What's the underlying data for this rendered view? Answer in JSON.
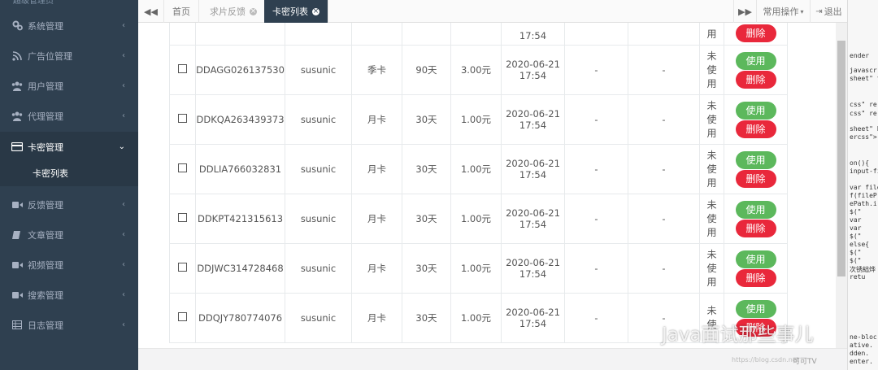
{
  "sidebar": {
    "top_text": "超级管理员",
    "items": [
      {
        "label": "系统管理",
        "icon": "gears-icon"
      },
      {
        "label": "广告位管理",
        "icon": "rss-icon"
      },
      {
        "label": "用户管理",
        "icon": "users-icon"
      },
      {
        "label": "代理管理",
        "icon": "users-icon"
      },
      {
        "label": "卡密管理",
        "icon": "credit-card-icon"
      },
      {
        "label": "反馈管理",
        "icon": "video-icon"
      },
      {
        "label": "文章管理",
        "icon": "book-icon"
      },
      {
        "label": "视频管理",
        "icon": "video-icon"
      },
      {
        "label": "搜索管理",
        "icon": "video-icon"
      },
      {
        "label": "日志管理",
        "icon": "table-icon"
      }
    ],
    "submenu_label": "卡密列表"
  },
  "topbar": {
    "tabs": [
      {
        "label": "首页"
      },
      {
        "label": "求片反馈"
      },
      {
        "label": "卡密列表"
      }
    ],
    "common_ops": "常用操作",
    "logout": "退出"
  },
  "table": {
    "partial_row": {
      "date_time": "17:54",
      "status_char": "用"
    },
    "rows": [
      {
        "code": "DDAGG026137530",
        "user": "susunic",
        "type": "季卡",
        "days": "90天",
        "price": "3.00元",
        "date": "2020-06-21",
        "time": "17:54",
        "col8": "-",
        "col9": "-",
        "status": [
          "未",
          "使",
          "用"
        ]
      },
      {
        "code": "DDKQA263439373",
        "user": "susunic",
        "type": "月卡",
        "days": "30天",
        "price": "1.00元",
        "date": "2020-06-21",
        "time": "17:54",
        "col8": "-",
        "col9": "-",
        "status": [
          "未",
          "使",
          "用"
        ]
      },
      {
        "code": "DDLIA766032831",
        "user": "susunic",
        "type": "月卡",
        "days": "30天",
        "price": "1.00元",
        "date": "2020-06-21",
        "time": "17:54",
        "col8": "-",
        "col9": "-",
        "status": [
          "未",
          "使",
          "用"
        ]
      },
      {
        "code": "DDKPT421315613",
        "user": "susunic",
        "type": "月卡",
        "days": "30天",
        "price": "1.00元",
        "date": "2020-06-21",
        "time": "17:54",
        "col8": "-",
        "col9": "-",
        "status": [
          "未",
          "使",
          "用"
        ]
      },
      {
        "code": "DDJWC314728468",
        "user": "susunic",
        "type": "月卡",
        "days": "30天",
        "price": "1.00元",
        "date": "2020-06-21",
        "time": "17:54",
        "col8": "-",
        "col9": "-",
        "status": [
          "未",
          "使",
          "用"
        ]
      },
      {
        "code": "DDQJY780774076",
        "user": "susunic",
        "type": "月卡",
        "days": "30天",
        "price": "1.00元",
        "date": "2020-06-21",
        "time": "17:54",
        "col8": "-",
        "col9": "-",
        "status": [
          "未",
          "使"
        ]
      }
    ],
    "use_label": "使用",
    "delete_label": "删除"
  },
  "right_panel": {
    "lines": [
      "ender",
      "javascr",
      "sheet\" t",
      "css\" re",
      "css\" re",
      "sheet\" h",
      "ercss\">",
      "on(){",
      "input-fi",
      "var file",
      "f(fileP",
      "ePath.i",
      "$(\"",
      "var",
      "var",
      "$(\"",
      "else{",
      "$(\"",
      "$(\"",
      "次锈絀烨",
      "retu",
      "ne-bloc",
      "ative.",
      "dden.",
      "enter."
    ]
  },
  "watermark": {
    "text": "Java面试那些事儿",
    "small": "可可TV",
    "url": "https://blog.csdn.net"
  },
  "colors": {
    "sidebar_bg": "#2f4050",
    "use_green": "#5cb85c",
    "delete_red": "#e9283b"
  }
}
